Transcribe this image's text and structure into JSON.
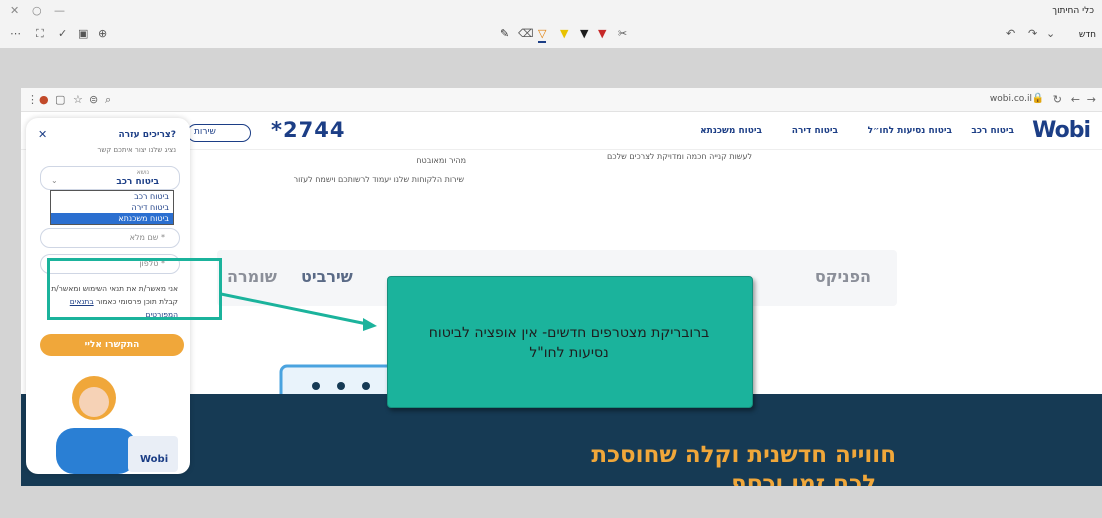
{
  "editor": {
    "title": "כלי החיתוך",
    "new_label": "חדש",
    "toolbar_icons": [
      "more-icon",
      "crop-icon",
      "check-icon",
      "save-icon",
      "zoom-icon"
    ],
    "pen_colors": [
      "#333333",
      "#555555",
      "#e07b00",
      "#e8c200",
      "#1c1c1c",
      "#c62828"
    ]
  },
  "browser": {
    "url": "wobi.co.il"
  },
  "site": {
    "logo": "Wobi",
    "nav": [
      "ביטוח רכב",
      "ביטוח נסיעות לחו״ל",
      "ביטוח דירה",
      "ביטוח משכנתא"
    ],
    "phone": "*2744",
    "service_btn": "שירות",
    "line1": "לעשות קנייה חכמה ומדויקת לצרכים שלכם",
    "line2": "מהיר ומאובטח",
    "line3": "שירות הלקוחות שלנו יעמוד לרשותכם וישמח לעזור",
    "partners": [
      "הפניקס",
      "שירביט",
      "שומרה"
    ],
    "hero_line1": "חווייה חדשנית וקלה שחוסכת",
    "hero_line2": "לכם זמן וכסף"
  },
  "chat": {
    "title": "צריכים עזרה?",
    "subtitle": "נציג שלנו יצור איתכם קשר",
    "select_small_label": "נושא",
    "select_value": "ביטוח רכב",
    "options": [
      "ביטוח רכב",
      "ביטוח דירה",
      "ביטוח משכנתא"
    ],
    "name_label": "שם מלא *",
    "phone_label": "טלפון *",
    "consent_text": "אני מאשר/ת את תנאי השימוש ומאשר/ת קבלת תוכן פרסומי כאמור",
    "consent_link": "בתנאים המפורטים",
    "cta": "התקשרו אליי"
  },
  "annotation": {
    "text": "ברובריקת מצטרפים חדשים- אין אופציה לביטוח נסיעות לחו\"ל",
    "color": "#1bb39c"
  }
}
